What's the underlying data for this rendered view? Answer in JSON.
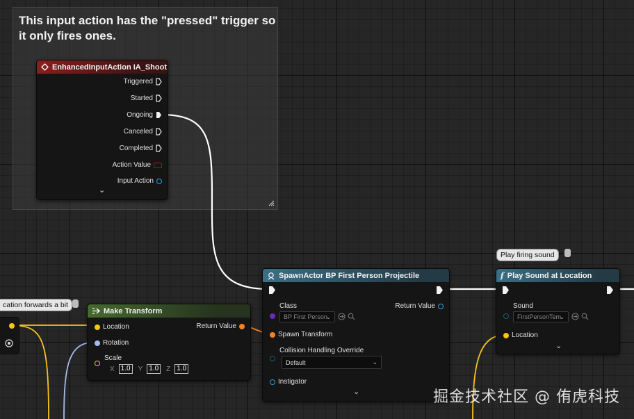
{
  "comment": {
    "text": "This input action has the \"pressed\" trigger so it only fires ones."
  },
  "input_action_node": {
    "title": "EnhancedInputAction IA_Shoot",
    "pins": [
      "Triggered",
      "Started",
      "Ongoing",
      "Canceled",
      "Completed",
      "Action Value",
      "Input Action"
    ],
    "expand": "⌄"
  },
  "spawn_node": {
    "title": "SpawnActor BP First Person Projectile",
    "class_label": "Class",
    "class_value": "BP First Person",
    "return_label": "Return Value",
    "spawn_transform_label": "Spawn Transform",
    "collision_label": "Collision Handling Override",
    "collision_value": "Default",
    "instigator_label": "Instigator",
    "expand": "⌄"
  },
  "make_transform_node": {
    "title": "Make Transform",
    "location_label": "Location",
    "rotation_label": "Rotation",
    "scale_label": "Scale",
    "return_label": "Return Value",
    "scale_x_label": "X",
    "scale_x": "1.0",
    "scale_y_label": "Y",
    "scale_y": "1.0",
    "scale_z_label": "Z",
    "scale_z": "1.0"
  },
  "play_sound_node": {
    "bubble": "Play firing sound",
    "title": "Play Sound at Location",
    "sound_label": "Sound",
    "sound_value": "FirstPersonTem",
    "location_label": "Location",
    "expand": "⌄"
  },
  "left_fragment": {
    "bubble": "cation forwards a bit"
  },
  "watermark": "掘金技术社区 @ 侑虎科技",
  "colors": {
    "exec_wire": "#ffffff",
    "vector_pin": "#f5c518",
    "transform_pin": "#f58220",
    "rotator_pin": "#a6b9ee",
    "object_pin": "#2ba1e0"
  }
}
